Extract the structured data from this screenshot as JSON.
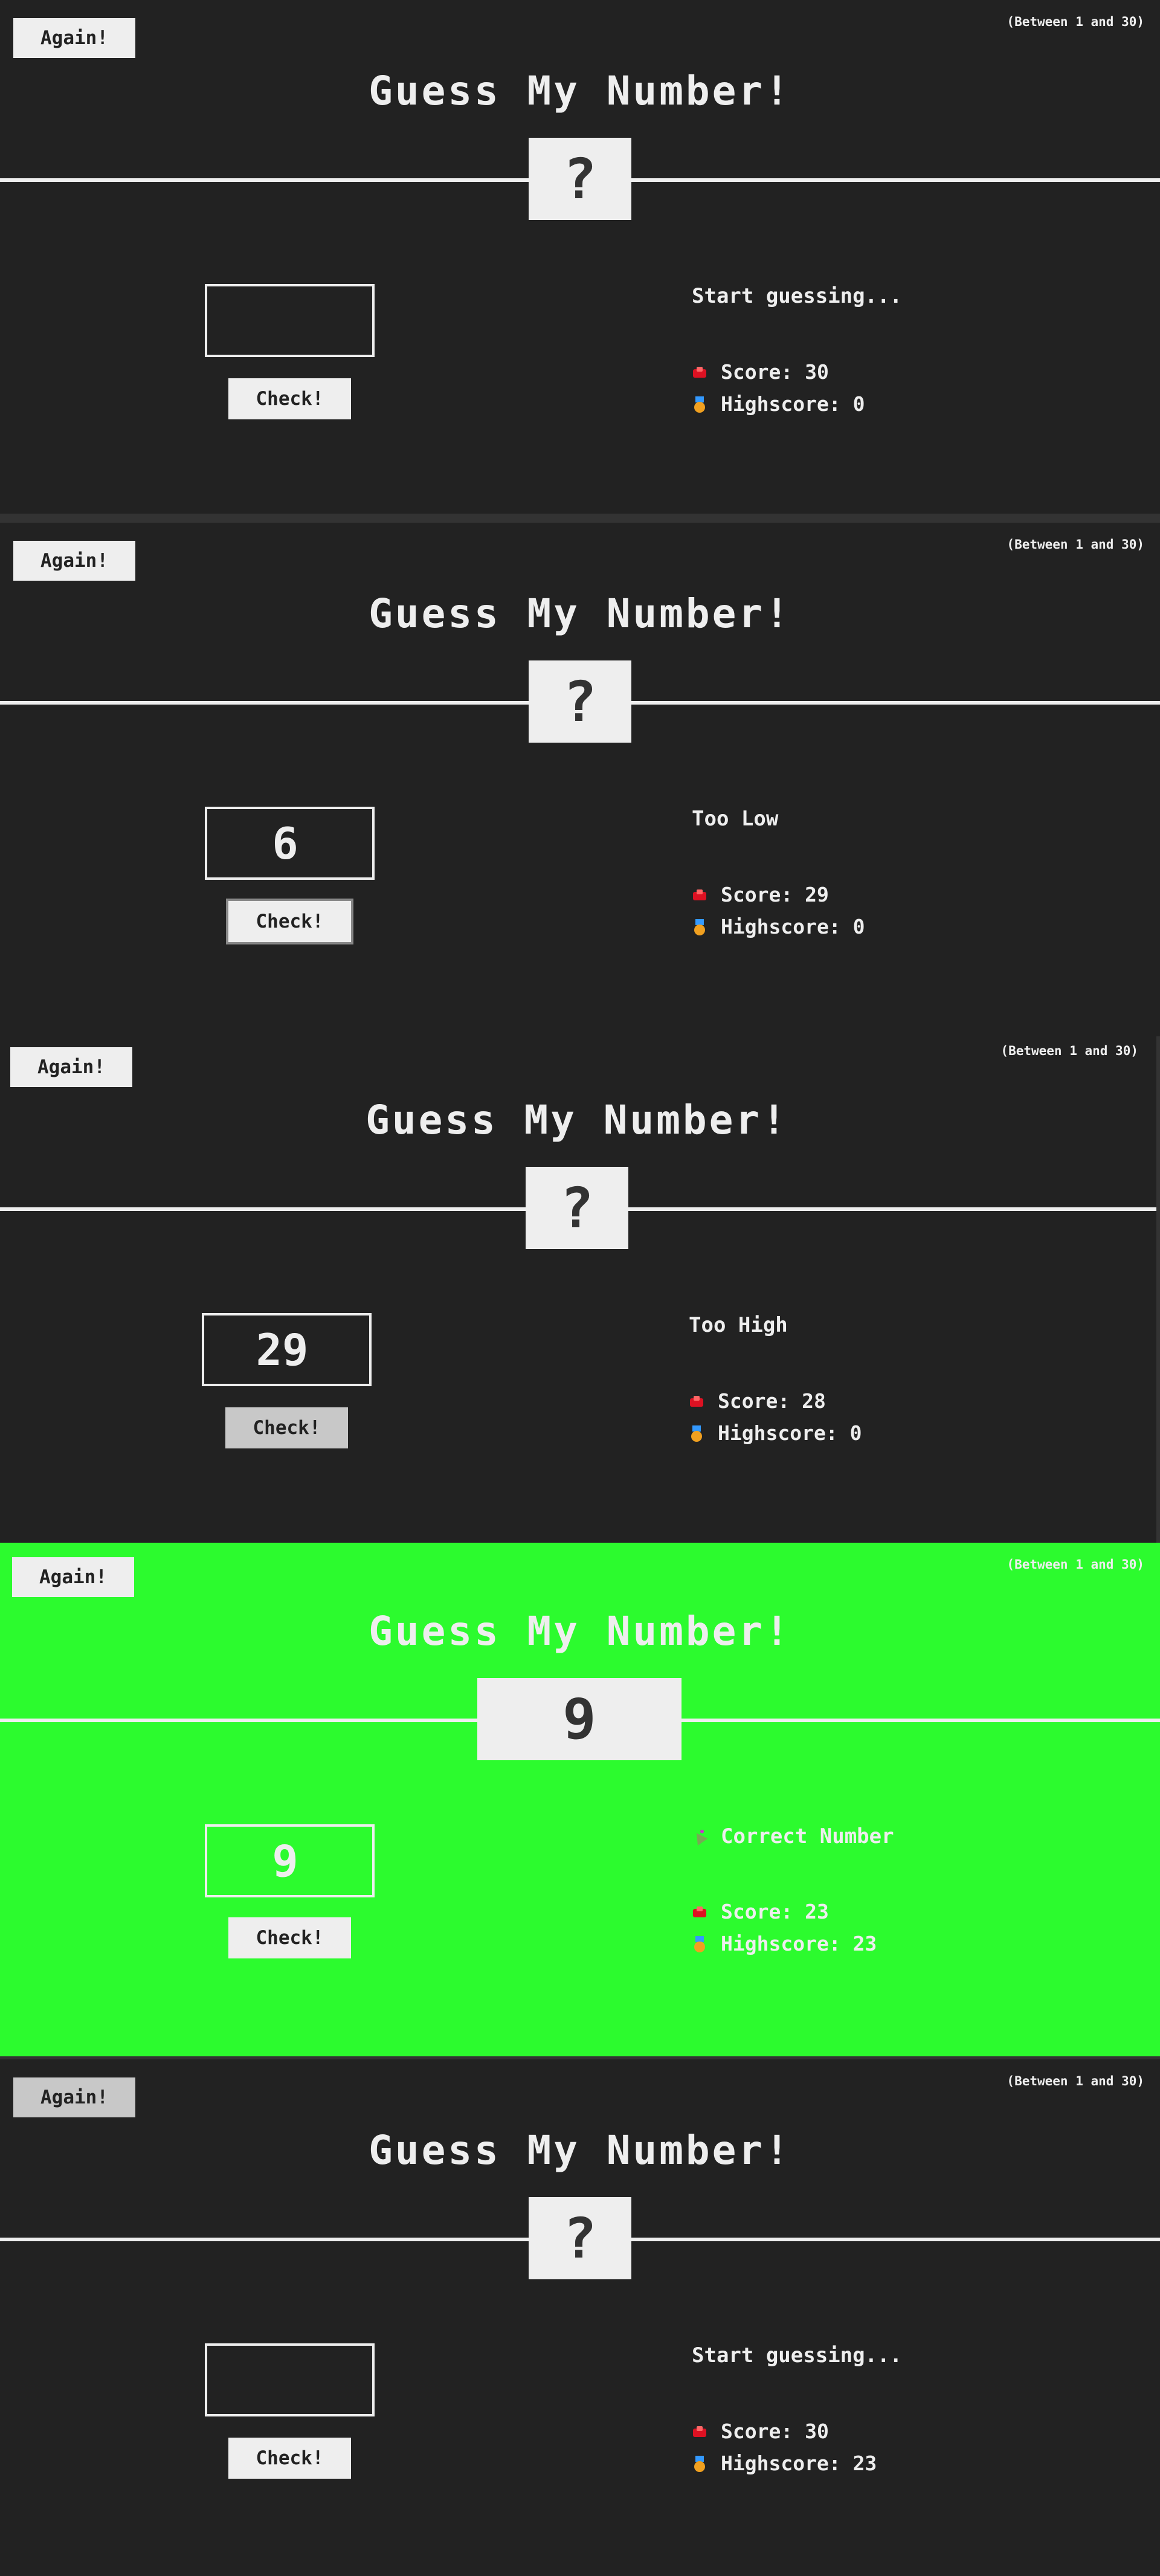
{
  "app": {
    "title": "Guess My Number!",
    "between": "(Between 1 and 30)",
    "again_label": "Again!",
    "check_label": "Check!",
    "score_label": "Score:",
    "highscore_label": "Highscore:"
  },
  "states": [
    {
      "secret": "?",
      "guess": "",
      "message": "Start guessing...",
      "score": "30",
      "highscore": "0"
    },
    {
      "secret": "?",
      "guess": "6",
      "message": "Too Low",
      "score": "29",
      "highscore": "0"
    },
    {
      "secret": "?",
      "guess": "29",
      "message": "Too High",
      "score": "28",
      "highscore": "0"
    },
    {
      "secret": "9",
      "guess": "9",
      "message": "Correct Number",
      "score": "23",
      "highscore": "23"
    },
    {
      "secret": "?",
      "guess": "",
      "message": "Start guessing...",
      "score": "30",
      "highscore": "23"
    }
  ],
  "colors": {
    "background": "#222222",
    "win_background": "#2cfb2e",
    "foreground": "#eeeeee"
  },
  "icons": {
    "score": "score-chart-icon",
    "highscore": "medal-icon",
    "correct": "party-popper-icon"
  }
}
